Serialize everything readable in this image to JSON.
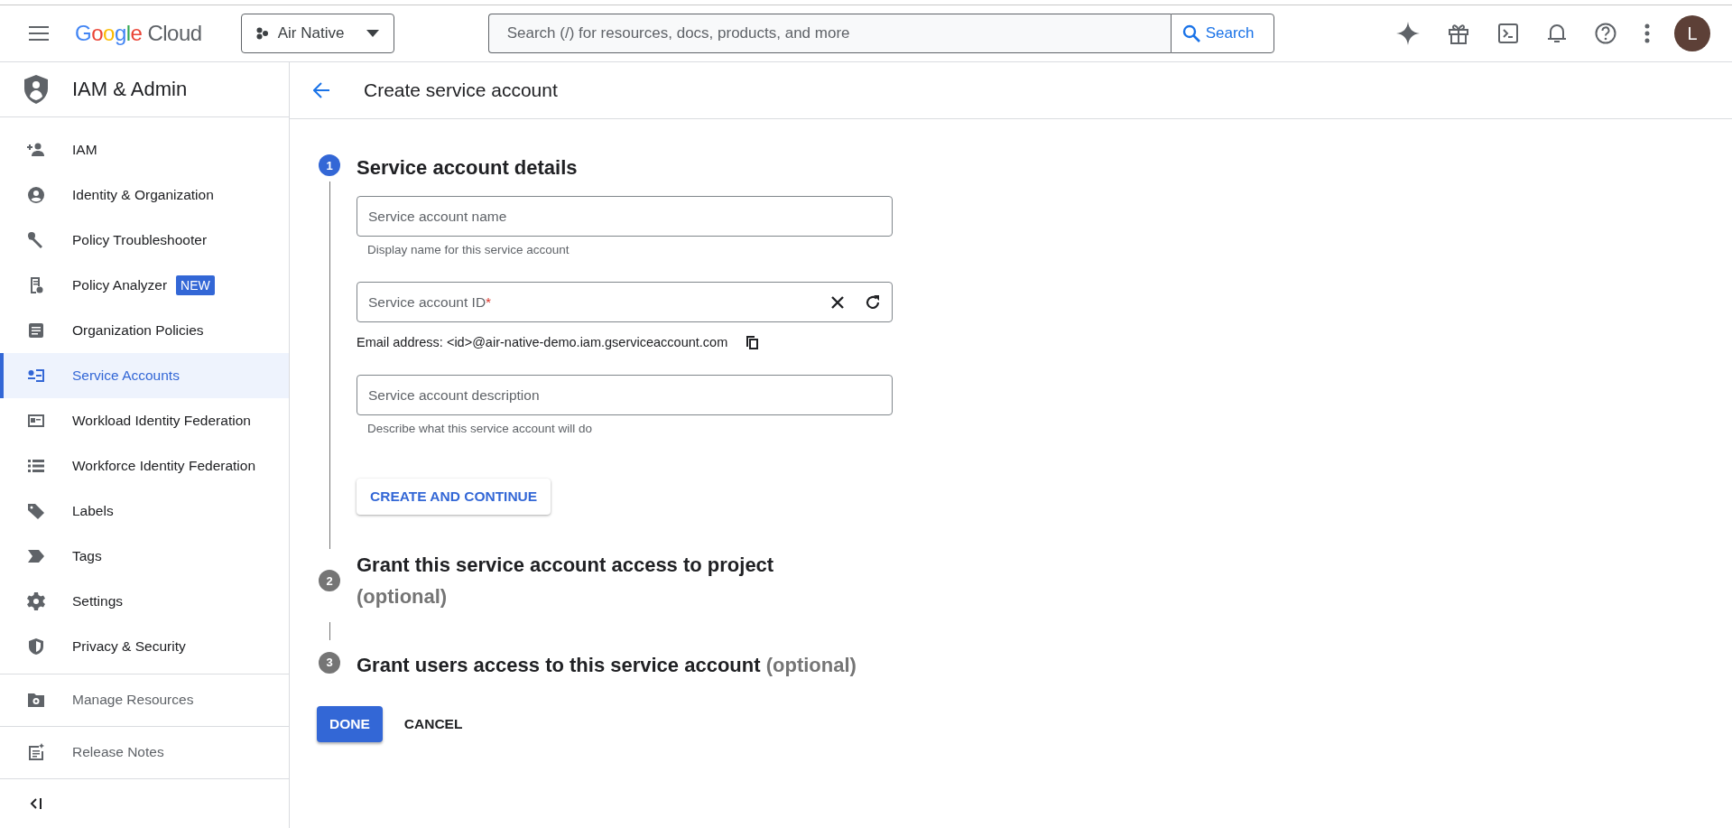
{
  "topbar": {
    "logo": {
      "word1": "Google",
      "word2": "Cloud"
    },
    "project": "Air Native",
    "search": {
      "placeholder": "Search (/) for resources, docs, products, and more",
      "button": "Search"
    },
    "avatar": "L"
  },
  "sidebar": {
    "title": "IAM & Admin",
    "items": [
      {
        "label": "IAM",
        "selected": false
      },
      {
        "label": "Identity & Organization",
        "selected": false
      },
      {
        "label": "Policy Troubleshooter",
        "selected": false
      },
      {
        "label": "Policy Analyzer",
        "badge": "NEW",
        "selected": false
      },
      {
        "label": "Organization Policies",
        "selected": false
      },
      {
        "label": "Service Accounts",
        "selected": true
      },
      {
        "label": "Workload Identity Federation",
        "selected": false
      },
      {
        "label": "Workforce Identity Federation",
        "selected": false
      },
      {
        "label": "Labels",
        "selected": false
      },
      {
        "label": "Tags",
        "selected": false
      },
      {
        "label": "Settings",
        "selected": false
      },
      {
        "label": "Privacy & Security",
        "selected": false
      }
    ],
    "footer": [
      {
        "label": "Manage Resources"
      },
      {
        "label": "Release Notes"
      }
    ]
  },
  "page": {
    "title": "Create service account"
  },
  "steps": [
    {
      "number": "1",
      "title": "Service account details",
      "active": true
    },
    {
      "number": "2",
      "title": "Grant this service account access to project",
      "note": "(optional)",
      "active": false
    },
    {
      "number": "3",
      "title": "Grant users access to this service account",
      "note": "(optional)",
      "active": false
    }
  ],
  "details": {
    "fields": [
      {
        "label": "Service account name",
        "helper": "Display name for this service account"
      },
      {
        "label": "Service account ID",
        "required": "*",
        "actions": true,
        "email": "Email address: <id>@air-native-demo.iam.gserviceaccount.com"
      },
      {
        "label": "Service account description",
        "helper": "Describe what this service account will do"
      }
    ],
    "button": "CREATE AND CONTINUE"
  },
  "buttons": {
    "done": "DONE",
    "cancel": "CANCEL"
  }
}
